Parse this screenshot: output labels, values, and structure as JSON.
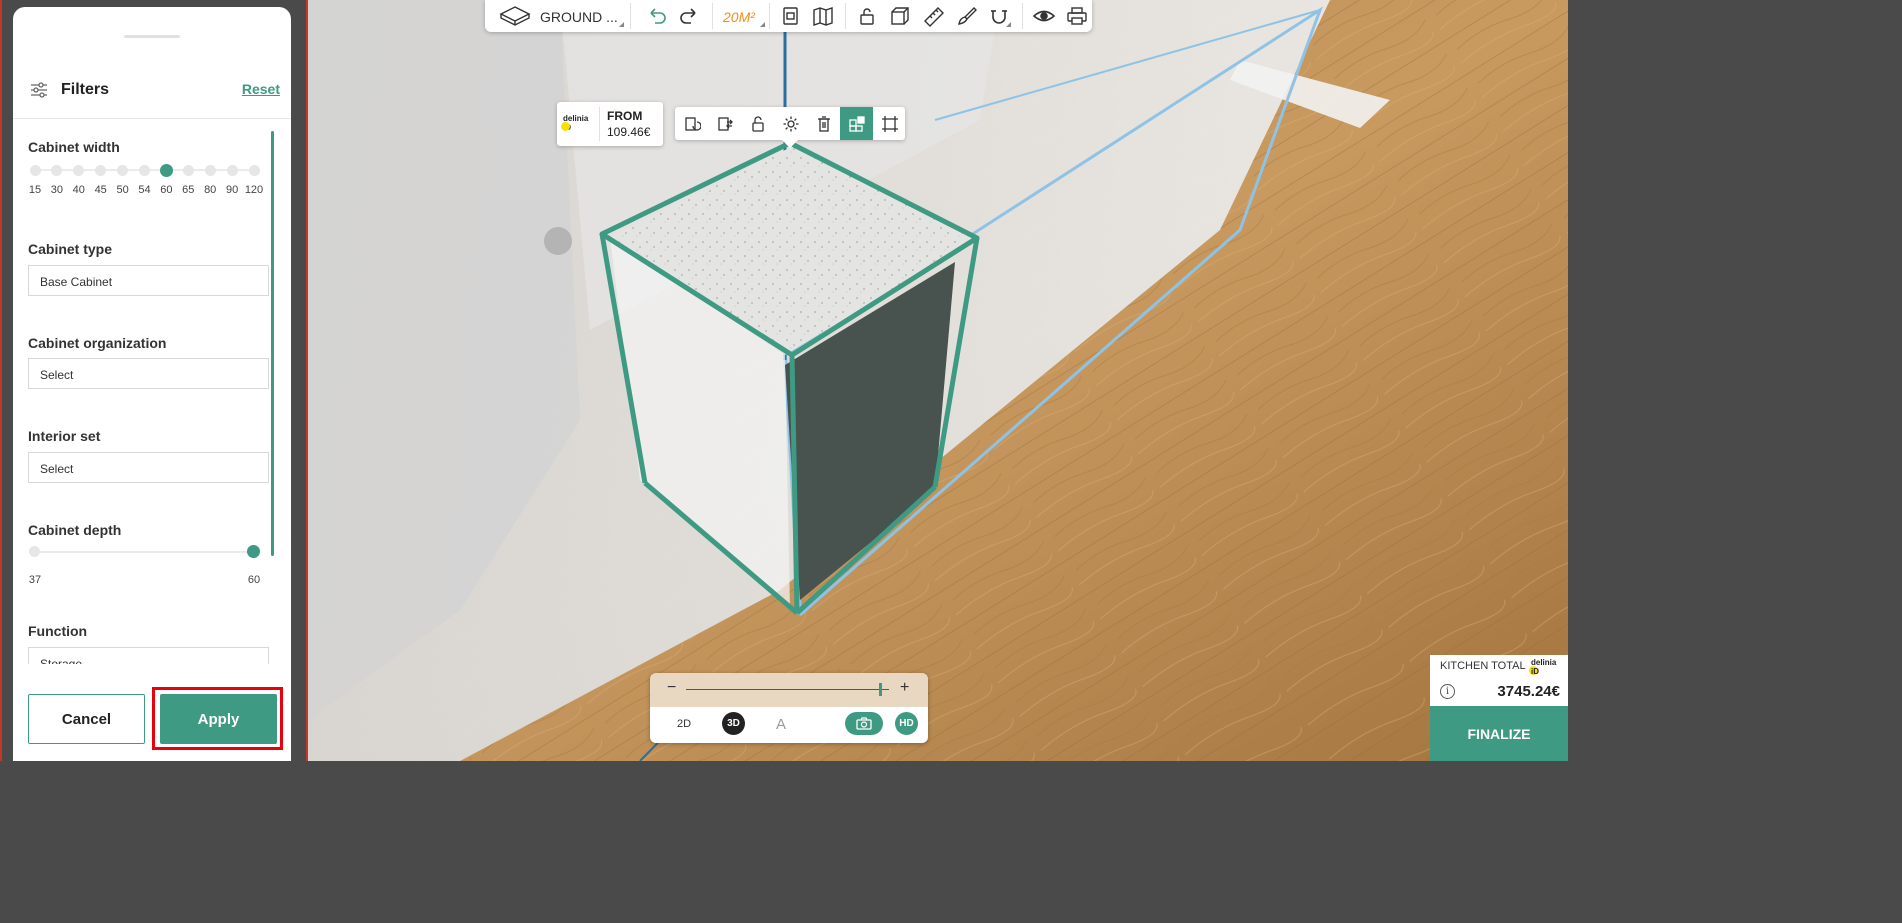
{
  "panel": {
    "title": "Filters",
    "reset_label": "Reset",
    "cabinet_width": {
      "label": "Cabinet width",
      "options": [
        "15",
        "30",
        "40",
        "45",
        "50",
        "54",
        "60",
        "65",
        "80",
        "90",
        "120"
      ],
      "selected": "60"
    },
    "cabinet_type": {
      "label": "Cabinet type",
      "value": "Base Cabinet"
    },
    "cabinet_organization": {
      "label": "Cabinet organization",
      "value": "Select"
    },
    "interior_set": {
      "label": "Interior set",
      "value": "Select"
    },
    "cabinet_depth": {
      "label": "Cabinet depth",
      "min": "37",
      "max": "60",
      "value": 60
    },
    "function": {
      "label": "Function",
      "value": "Storage"
    },
    "cancel_label": "Cancel",
    "apply_label": "Apply"
  },
  "toolbar": {
    "level_label": "GROUND ...",
    "area_label": "20M²",
    "icons": [
      "floor-plan-icon",
      "undo-icon",
      "redo-icon",
      "document-icon",
      "map-icon",
      "lock-icon",
      "cube-icon",
      "ruler-icon",
      "paint-brush-icon",
      "magnet-icon",
      "eye-icon",
      "print-icon"
    ]
  },
  "price_tag": {
    "from_label": "FROM",
    "price": "109.46€",
    "logo_top": "delinia",
    "logo_bottom": "iD"
  },
  "object_toolbar": {
    "icons": [
      "replace-icon",
      "swap-icon",
      "unlock-icon",
      "settings-icon",
      "delete-icon",
      "catalog-icon",
      "resize-icon"
    ],
    "active": "catalog-icon"
  },
  "view_bar": {
    "zoom_minus": "−",
    "zoom_plus": "+",
    "zoom_level": 0.96,
    "mode_2d": "2D",
    "mode_3d": "3D",
    "mode_a": "A",
    "hd_label": "HD"
  },
  "total": {
    "label": "KITCHEN TOTAL",
    "value": "3745.24€",
    "info": "i",
    "finalize_label": "FINALIZE",
    "logo_top": "delinia",
    "logo_bottom": "iD"
  },
  "colors": {
    "accent": "#3e9a82",
    "highlight": "#e8000b",
    "area": "#f28c1b",
    "selection_box": "#3e9a82",
    "guide_box": "#8fc3e6"
  }
}
